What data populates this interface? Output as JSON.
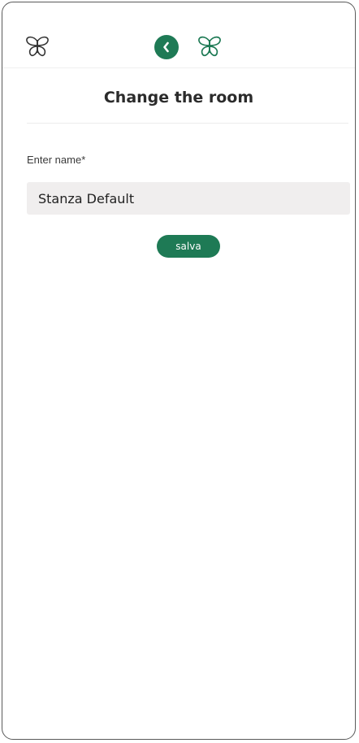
{
  "header": {
    "left_icon": "butterfly-logo-icon",
    "back_icon": "back-circle-icon",
    "right_icon": "butterfly-logo-icon"
  },
  "page": {
    "title": "Change the room"
  },
  "form": {
    "name_label": "Enter name*",
    "name_value": "Stanza Default",
    "save_label": "salva"
  },
  "colors": {
    "accent": "#1e7a55",
    "input_background": "#f0eeee",
    "text": "#2b2b2b"
  }
}
